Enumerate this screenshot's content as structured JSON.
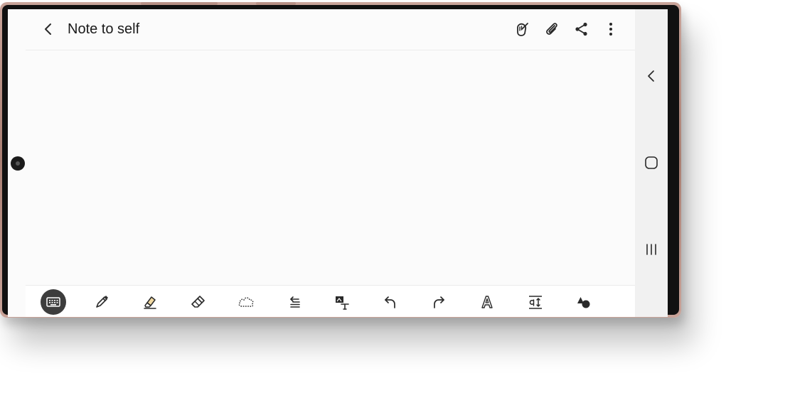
{
  "app": {
    "title": "Note to self",
    "icons": [
      "back-arrow-icon",
      "pen-hand-icon",
      "paperclip-icon",
      "share-icon",
      "more-vert-icon"
    ]
  },
  "navigation": {
    "icons": [
      "nav-back-icon",
      "nav-home-icon",
      "nav-recents-icon"
    ]
  },
  "toolbar": {
    "active_tool": "keyboard",
    "tools": [
      "keyboard",
      "pen",
      "highlighter",
      "eraser",
      "lasso",
      "text-align",
      "image-to-text",
      "undo",
      "redo",
      "text-style",
      "font-size",
      "shapes"
    ]
  },
  "colors": {
    "screen_bg": "#fbfbfb",
    "icon": "#2a2a2a",
    "active_tool_bg": "#3d3d3d",
    "highlighter_accent": "#f1d9a2",
    "frame": "#b89186"
  }
}
